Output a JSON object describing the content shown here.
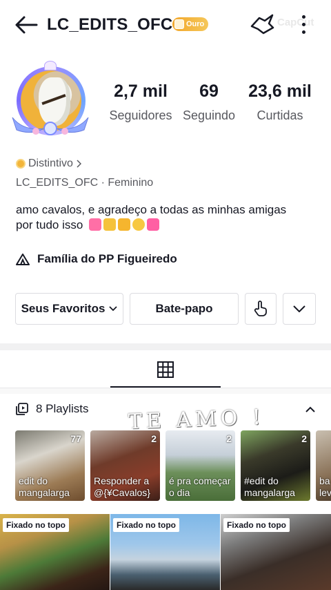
{
  "header": {
    "username": "LC_EDITS_OFC",
    "badge_label": "Ouro",
    "watermark": "CapCut"
  },
  "stats": [
    {
      "value": "2,7 mil",
      "label": "Seguidores"
    },
    {
      "value": "69",
      "label": "Seguindo"
    },
    {
      "value": "23,6 mil",
      "label": "Curtidas"
    }
  ],
  "profile": {
    "distintivo_label": "Distintivo",
    "user_line": "LC_EDITS_OFC · Feminino",
    "bio_line1": "amo cavalos, e agradeço a todas as minhas amigas",
    "bio_line2": "por tudo isso",
    "family_label": "Família do PP Figueiredo"
  },
  "buttons": {
    "favorites": "Seus Favoritos",
    "chat": "Bate-papo"
  },
  "playlists": {
    "header": "8 Playlists",
    "overlay_text": "TE AMO !",
    "items": [
      {
        "count": "77",
        "title": "edit do mangalarga"
      },
      {
        "count": "2",
        "title": "Responder a @{¥Cavalos}"
      },
      {
        "count": "2",
        "title": "é pra começar o dia"
      },
      {
        "count": "2",
        "title": "#edit do mangalarga"
      },
      {
        "count": "",
        "title": "ba lev"
      }
    ]
  },
  "pinned": {
    "label": "Fixado no topo"
  },
  "colors": {
    "text": "#161823",
    "secondary": "#57585e",
    "badge_gold": "#f2a72b",
    "avatar_ring": "#9b8cff"
  }
}
